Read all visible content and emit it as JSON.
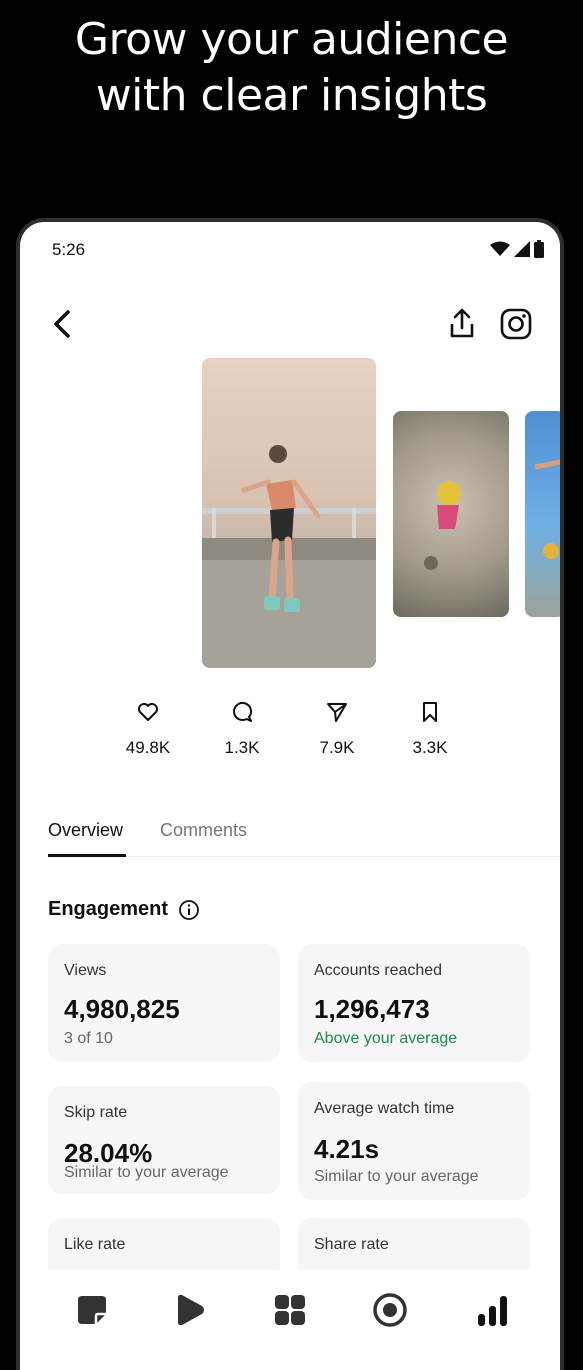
{
  "headline": {
    "line1": "Grow your audience",
    "line2": "with clear insights"
  },
  "status_bar": {
    "time": "5:26",
    "icons": [
      "wifi-icon",
      "signal-icon",
      "battery-icon"
    ]
  },
  "top_bar": {
    "icons": [
      "back-icon",
      "share-icon",
      "instagram-icon"
    ]
  },
  "stats": [
    {
      "icon": "heart-icon",
      "value": "49.8K"
    },
    {
      "icon": "comment-icon",
      "value": "1.3K"
    },
    {
      "icon": "send-icon",
      "value": "7.9K"
    },
    {
      "icon": "bookmark-icon",
      "value": "3.3K"
    }
  ],
  "tabs": [
    {
      "label": "Overview",
      "active": true
    },
    {
      "label": "Comments",
      "active": false
    }
  ],
  "engagement": {
    "title": "Engagement",
    "cards": [
      {
        "label": "Views",
        "value": "4,980,825",
        "sub": "3 of 10"
      },
      {
        "label": "Accounts reached",
        "value": "1,296,473",
        "sub": "Above your average"
      },
      {
        "label": "Skip rate",
        "value": "28.04%",
        "sub": "Similar to your average"
      },
      {
        "label": "Average watch time",
        "value": "4.21s",
        "sub": "Similar to your average"
      },
      {
        "label": "Like rate"
      },
      {
        "label": "Share rate"
      }
    ]
  },
  "bottom_nav": [
    "stickers-icon",
    "play-icon",
    "grid-icon",
    "record-icon",
    "insights-icon"
  ],
  "colors": {
    "background": "#000000",
    "card": "#f7f5f8",
    "positive": "#1f8a4c",
    "muted_text": "#777777"
  }
}
